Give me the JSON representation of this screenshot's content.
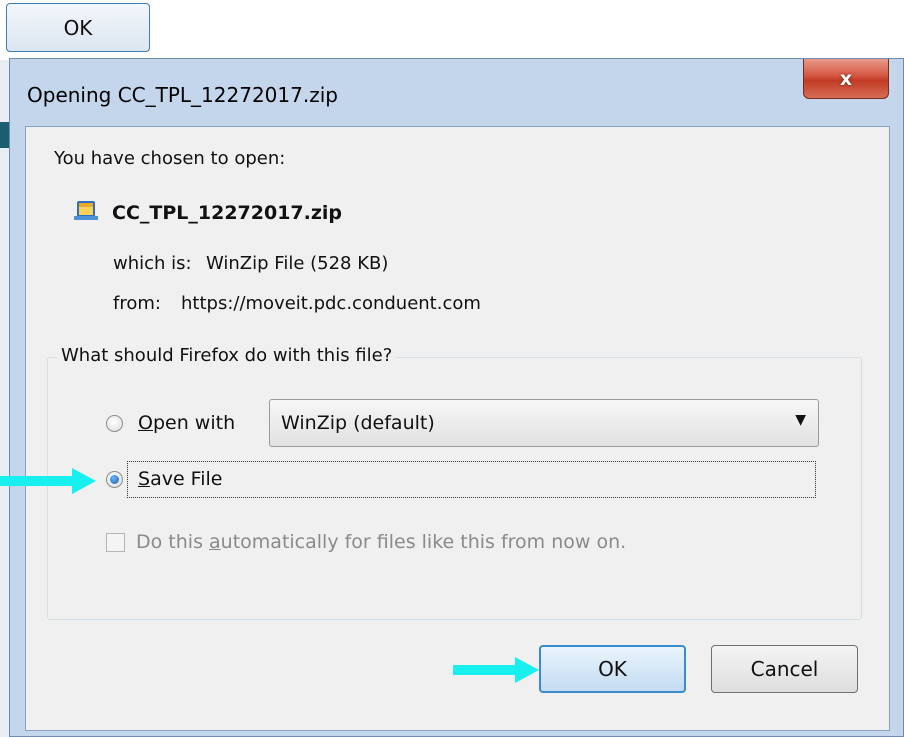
{
  "background": {
    "ok_button_label": "OK"
  },
  "dialog": {
    "title": "Opening CC_TPL_12272017.zip",
    "close_glyph": "x",
    "intro": "You have chosen to open:",
    "file_name": "CC_TPL_12272017.zip",
    "file_icon": "winzip-file-icon",
    "which_is_label": "which is:",
    "which_is_value": "WinZip File (528 KB)",
    "from_label": "from:",
    "from_value": "https://moveit.pdc.conduent.com",
    "question": "What should Firefox do with this file?",
    "open_with": {
      "label_first": "O",
      "label_rest": "pen with",
      "selected": false
    },
    "app_select": {
      "value": "WinZip (default)"
    },
    "save_file": {
      "label_first": "S",
      "label_rest": "ave File",
      "selected": true
    },
    "auto": {
      "label_before": "Do this ",
      "label_underlined": "a",
      "label_after": "utomatically for files like this from now on.",
      "checked": false,
      "enabled": false
    },
    "ok_label": "OK",
    "cancel_label": "Cancel"
  },
  "colors": {
    "annotation_arrow": "#18f0f0",
    "title_bar": "#c3d6ec",
    "close_button": "#c8432c"
  }
}
